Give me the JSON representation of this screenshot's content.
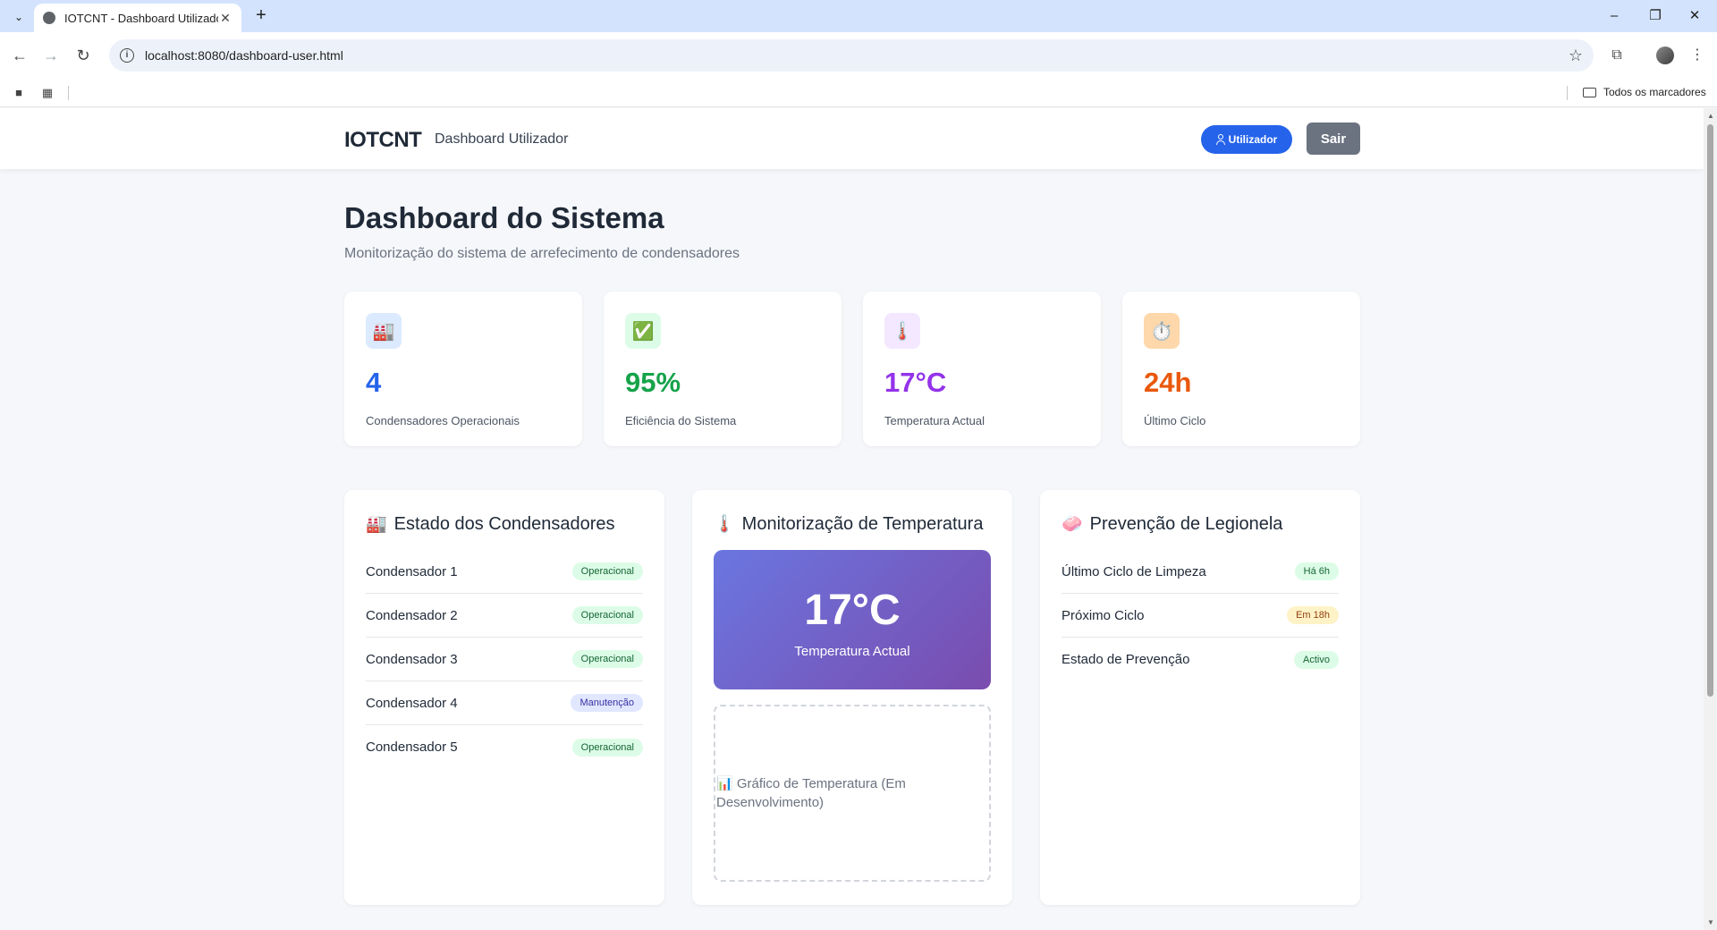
{
  "browser": {
    "tab_title": "IOTCNT - Dashboard Utilizador",
    "url": "localhost:8080/dashboard-user.html",
    "bookmarks_all": "Todos os marcadores",
    "icons": [
      "back-icon",
      "forward-icon",
      "reload-icon",
      "info-icon",
      "star-icon",
      "extensions-icon",
      "menu-icon"
    ]
  },
  "header": {
    "brand": "IOTCNT",
    "subtitle": "Dashboard Utilizador",
    "user_label": "Utilizador",
    "logout_label": "Sair",
    "accent_color": "#2563eb"
  },
  "page": {
    "title": "Dashboard do Sistema",
    "subtitle": "Monitorização do sistema de arrefecimento de condensadores"
  },
  "stats": [
    {
      "icon": "factory-icon",
      "glyph": "🏭",
      "value": "4",
      "label": "Condensadores Operacionais",
      "color": "#2563eb",
      "bg": "#dbeafe"
    },
    {
      "icon": "check-icon",
      "glyph": "✅",
      "value": "95%",
      "label": "Eficiência do Sistema",
      "color": "#16a34a",
      "bg": "#dcfce7"
    },
    {
      "icon": "thermometer-icon",
      "glyph": "🌡️",
      "value": "17°C",
      "label": "Temperatura Actual",
      "color": "#9333ea",
      "bg": "#f3e8ff"
    },
    {
      "icon": "stopwatch-icon",
      "glyph": "⏱️",
      "value": "24h",
      "label": "Último Ciclo",
      "color": "#ea580c",
      "bg": "#fed7aa"
    }
  ],
  "condensers": {
    "title": "Estado dos Condensadores",
    "glyph": "🏭",
    "items": [
      {
        "name": "Condensador 1",
        "status": "Operacional"
      },
      {
        "name": "Condensador 2",
        "status": "Operacional"
      },
      {
        "name": "Condensador 3",
        "status": "Operacional"
      },
      {
        "name": "Condensador 4",
        "status": "Manutenção"
      },
      {
        "name": "Condensador 5",
        "status": "Operacional"
      }
    ]
  },
  "temperature": {
    "title": "Monitorização de Temperatura",
    "glyph": "🌡️",
    "value": "17°C",
    "label": "Temperatura Actual",
    "chart_glyph": "📊",
    "chart_placeholder": "Gráfico de Temperatura (Em Desenvolvimento)"
  },
  "legionella": {
    "title": "Prevenção de Legionela",
    "glyph": "🧼",
    "items": [
      {
        "label": "Último Ciclo de Limpeza",
        "value": "Há 6h"
      },
      {
        "label": "Próximo Ciclo",
        "value": "Em 18h"
      },
      {
        "label": "Estado de Prevenção",
        "value": "Activo"
      }
    ]
  }
}
